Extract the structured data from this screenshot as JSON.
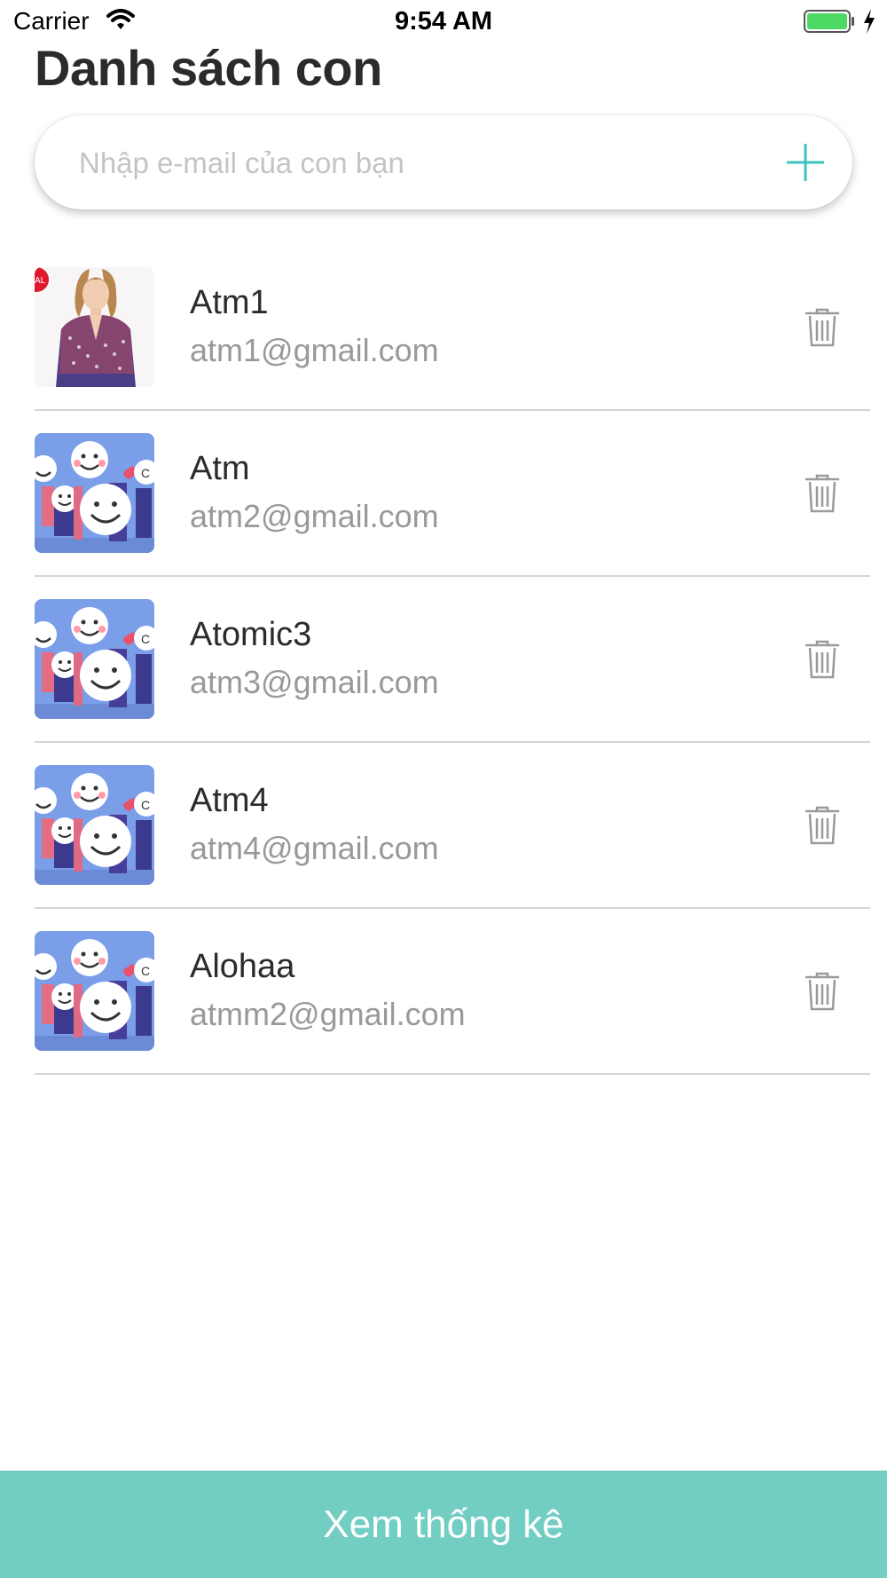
{
  "status_bar": {
    "carrier": "Carrier",
    "time": "9:54 AM",
    "battery_color": "#4cd964"
  },
  "title": "Danh sách con",
  "add_child": {
    "placeholder": "Nhập e-mail của con bạn",
    "value": "",
    "add_icon": "plus-icon",
    "accent_color": "#3cc4bb"
  },
  "children": [
    {
      "name": "Atm1",
      "email": "atm1@gmail.com",
      "avatar": "photo-woman"
    },
    {
      "name": "Atm",
      "email": "atm2@gmail.com",
      "avatar": "smiley-crowd"
    },
    {
      "name": "Atomic3",
      "email": "atm3@gmail.com",
      "avatar": "smiley-crowd"
    },
    {
      "name": "Atm4",
      "email": "atm4@gmail.com",
      "avatar": "smiley-crowd"
    },
    {
      "name": "Alohaa",
      "email": "atmm2@gmail.com",
      "avatar": "smiley-crowd"
    }
  ],
  "delete_icon": "trash-icon",
  "footer": {
    "stats_label": "Xem thống kê",
    "color": "#72cdc2"
  }
}
